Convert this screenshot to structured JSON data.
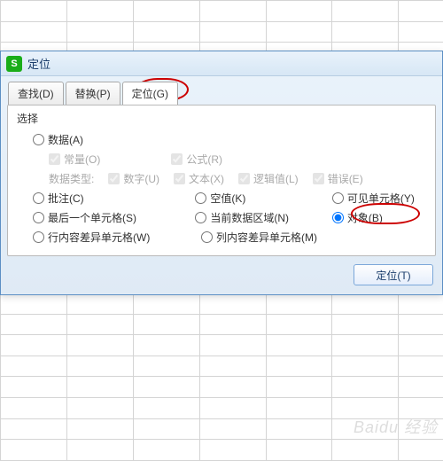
{
  "dialog": {
    "title": "定位",
    "icon_letter": "S"
  },
  "tabs": {
    "find": "查找(D)",
    "replace": "替换(P)",
    "goto": "定位(G)"
  },
  "panel": {
    "section": "选择",
    "radios": {
      "data": "数据(A)",
      "comment": "批注(C)",
      "lastcell": "最后一个单元格(S)",
      "rowdiff": "行内容差异单元格(W)",
      "blank": "空值(K)",
      "region": "当前数据区域(N)",
      "coldiff": "列内容差异单元格(M)",
      "visible": "可见单元格(Y)",
      "object": "对象(B)"
    },
    "checks": {
      "constant": "常量(O)",
      "formula": "公式(R)"
    },
    "datatype_label": "数据类型:",
    "types": {
      "number": "数字(U)",
      "text": "文本(X)",
      "logic": "逻辑值(L)",
      "error": "错误(E)"
    }
  },
  "buttons": {
    "ok": "定位(T)"
  },
  "watermark": "Baidu 经验"
}
